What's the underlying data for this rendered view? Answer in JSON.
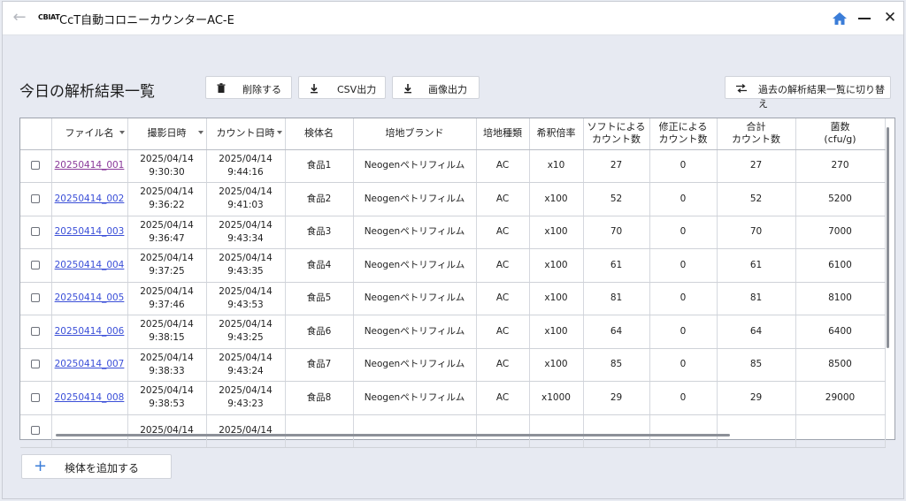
{
  "titlebar": {
    "logo": "CBIAT",
    "app_title": "CcT自動コロニーカウンターAC-E"
  },
  "page": {
    "title": "今日の解析結果一覧"
  },
  "toolbar": {
    "delete_label": "削除する",
    "csv_label": "CSV出力",
    "image_label": "画像出力",
    "switch_label": "過去の解析結果一覧に切り替え"
  },
  "table": {
    "headers": {
      "file": "ファイル名",
      "shot": "撮影日時",
      "count_date": "カウント日時",
      "sample": "検体名",
      "brand": "培地ブランド",
      "type": "培地種類",
      "dilution": "希釈倍率",
      "soft_1": "ソフトによる",
      "soft_2": "カウント数",
      "fix_1": "修正による",
      "fix_2": "カウント数",
      "total_1": "合計",
      "total_2": "カウント数",
      "cfu_1": "菌数",
      "cfu_2": "(cfu/g)"
    },
    "rows": [
      {
        "file": "20250414_001",
        "shot_d": "2025/04/14",
        "shot_t": "9:30:30",
        "cnt_d": "2025/04/14",
        "cnt_t": "9:44:16",
        "sample": "食品1",
        "brand": "Neogenペトリフィルム",
        "type": "AC",
        "dil": "x10",
        "soft": "27",
        "fix": "0",
        "total": "27",
        "cfu": "270"
      },
      {
        "file": "20250414_002",
        "shot_d": "2025/04/14",
        "shot_t": "9:36:22",
        "cnt_d": "2025/04/14",
        "cnt_t": "9:41:03",
        "sample": "食品2",
        "brand": "Neogenペトリフィルム",
        "type": "AC",
        "dil": "x100",
        "soft": "52",
        "fix": "0",
        "total": "52",
        "cfu": "5200"
      },
      {
        "file": "20250414_003",
        "shot_d": "2025/04/14",
        "shot_t": "9:36:47",
        "cnt_d": "2025/04/14",
        "cnt_t": "9:43:34",
        "sample": "食品3",
        "brand": "Neogenペトリフィルム",
        "type": "AC",
        "dil": "x100",
        "soft": "70",
        "fix": "0",
        "total": "70",
        "cfu": "7000"
      },
      {
        "file": "20250414_004",
        "shot_d": "2025/04/14",
        "shot_t": "9:37:25",
        "cnt_d": "2025/04/14",
        "cnt_t": "9:43:35",
        "sample": "食品4",
        "brand": "Neogenペトリフィルム",
        "type": "AC",
        "dil": "x100",
        "soft": "61",
        "fix": "0",
        "total": "61",
        "cfu": "6100"
      },
      {
        "file": "20250414_005",
        "shot_d": "2025/04/14",
        "shot_t": "9:37:46",
        "cnt_d": "2025/04/14",
        "cnt_t": "9:43:53",
        "sample": "食品5",
        "brand": "Neogenペトリフィルム",
        "type": "AC",
        "dil": "x100",
        "soft": "81",
        "fix": "0",
        "total": "81",
        "cfu": "8100"
      },
      {
        "file": "20250414_006",
        "shot_d": "2025/04/14",
        "shot_t": "9:38:15",
        "cnt_d": "2025/04/14",
        "cnt_t": "9:43:25",
        "sample": "食品6",
        "brand": "Neogenペトリフィルム",
        "type": "AC",
        "dil": "x100",
        "soft": "64",
        "fix": "0",
        "total": "64",
        "cfu": "6400"
      },
      {
        "file": "20250414_007",
        "shot_d": "2025/04/14",
        "shot_t": "9:38:33",
        "cnt_d": "2025/04/14",
        "cnt_t": "9:43:24",
        "sample": "食品7",
        "brand": "Neogenペトリフィルム",
        "type": "AC",
        "dil": "x100",
        "soft": "85",
        "fix": "0",
        "total": "85",
        "cfu": "8500"
      },
      {
        "file": "20250414_008",
        "shot_d": "2025/04/14",
        "shot_t": "9:38:53",
        "cnt_d": "2025/04/14",
        "cnt_t": "9:43:23",
        "sample": "食品8",
        "brand": "Neogenペトリフィルム",
        "type": "AC",
        "dil": "x1000",
        "soft": "29",
        "fix": "0",
        "total": "29",
        "cfu": "29000"
      },
      {
        "file": "",
        "shot_d": "2025/04/14",
        "shot_t": "",
        "cnt_d": "2025/04/14",
        "cnt_t": "",
        "sample": "",
        "brand": "",
        "type": "",
        "dil": "",
        "soft": "",
        "fix": "",
        "total": "",
        "cfu": ""
      }
    ]
  },
  "add": {
    "label": "検体を追加する"
  },
  "colors": {
    "accent": "#3b7dd8",
    "link": "#3b4fd8",
    "visited_link": "#8a3a9a"
  }
}
